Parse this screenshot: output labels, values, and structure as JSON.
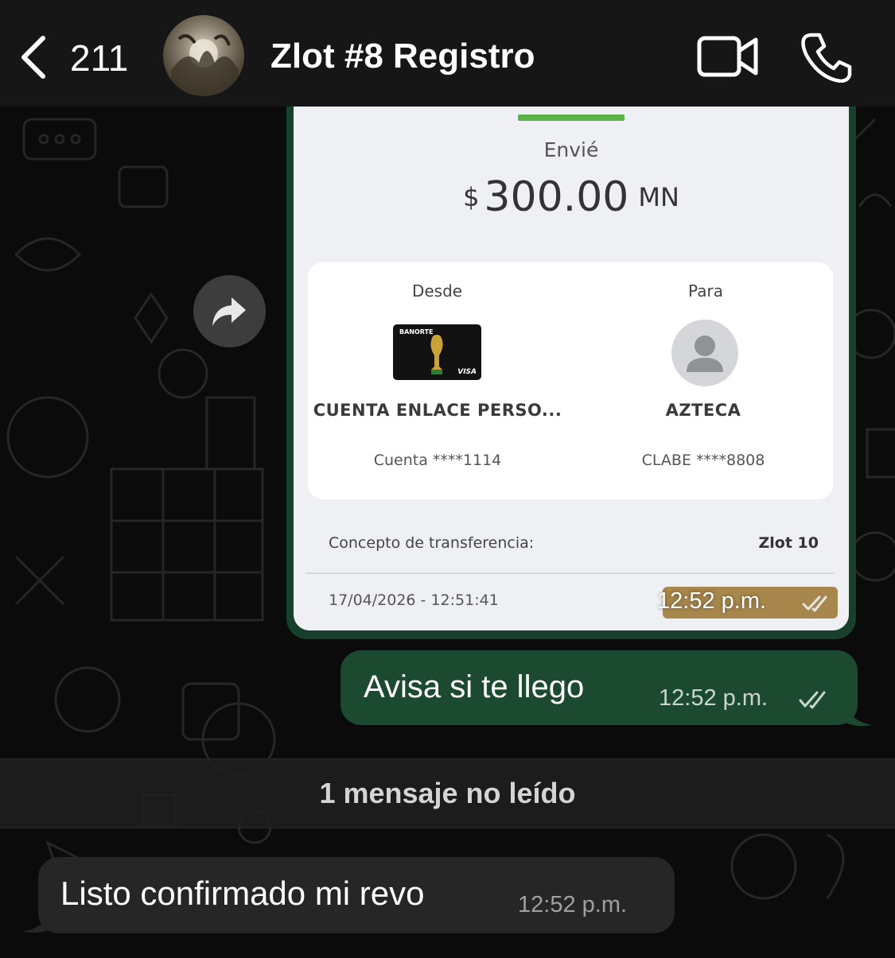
{
  "header": {
    "back_count": "211",
    "chat_title": "Zlot #8 Registro"
  },
  "receipt": {
    "sent_label": "Envié",
    "currency_symbol": "$",
    "amount": "300.00",
    "currency_code": "MN",
    "from_label": "Desde",
    "to_label": "Para",
    "from_bank_brand": "BANORTE",
    "from_card_network": "VISA",
    "from_account_name": "CUENTA ENLACE PERSO...",
    "from_account_number": "Cuenta ****1114",
    "to_account_name": "AZTECA",
    "to_account_number": "CLABE ****8808",
    "concept_label": "Concepto de transferencia:",
    "concept_value": "Zlot 10",
    "datetime": "17/04/2026 - 12:51:41"
  },
  "messages": {
    "image_time": "12:52 p.m.",
    "outgoing_text": "Avisa si te llego",
    "outgoing_time": "12:52 p.m.",
    "unread_divider": "1 mensaje no leído",
    "incoming_text": "Listo confirmado mi revo",
    "incoming_time": "12:52 p.m."
  },
  "colors": {
    "outgoing_bubble": "#1c4a30",
    "incoming_bubble": "#262626",
    "receipt_accent": "#5ab249",
    "header_bg": "#161616"
  },
  "icons": [
    "back-chevron-icon",
    "video-call-icon",
    "phone-call-icon",
    "forward-icon",
    "double-check-icon",
    "person-icon",
    "trophy-icon"
  ]
}
